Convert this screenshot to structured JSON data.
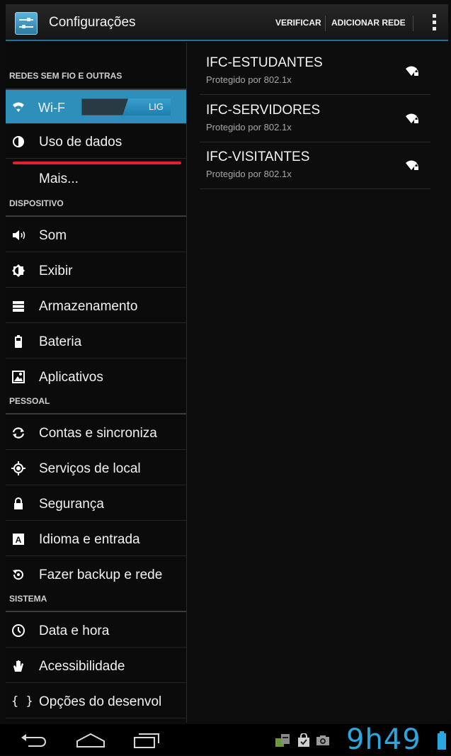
{
  "app": {
    "title": "Configurações"
  },
  "actionbar": {
    "verify_label": "VERIFICAR",
    "add_network_label": "ADICIONAR REDE"
  },
  "sections": {
    "wireless": "REDES SEM FIO E OUTRAS",
    "device": "DISPOSITIVO",
    "personal": "PESSOAL",
    "system": "SISTEMA"
  },
  "items": {
    "wifi": {
      "label": "Wi-F",
      "toggle": "LIG",
      "icon": "wifi-icon",
      "on": true
    },
    "data_usage": {
      "label": "Uso de dados",
      "icon": "data-usage-icon"
    },
    "more": {
      "label": "Mais..."
    },
    "sound": {
      "label": "Som",
      "icon": "speaker-icon"
    },
    "display": {
      "label": "Exibir",
      "icon": "brightness-icon"
    },
    "storage": {
      "label": "Armazenamento",
      "icon": "storage-icon"
    },
    "battery": {
      "label": "Bateria",
      "icon": "battery-icon"
    },
    "apps": {
      "label": "Aplicativos",
      "icon": "apps-icon"
    },
    "accounts": {
      "label": "Contas e sincroniza",
      "icon": "sync-icon"
    },
    "location": {
      "label": "Serviços de local",
      "icon": "location-icon"
    },
    "security": {
      "label": "Segurança",
      "icon": "lock-icon"
    },
    "language": {
      "label": "Idioma e entrada",
      "icon": "keyboard-icon"
    },
    "backup": {
      "label": "Fazer backup e rede",
      "icon": "backup-icon"
    },
    "datetime": {
      "label": "Data e hora",
      "icon": "clock-icon"
    },
    "accessibility": {
      "label": "Acessibilidade",
      "icon": "hand-icon"
    },
    "developer": {
      "label": "Opções do desenvol",
      "icon": "braces-icon"
    }
  },
  "networks": [
    {
      "ssid": "IFC-ESTUDANTES",
      "security": "Protegido por 802.1x"
    },
    {
      "ssid": "IFC-SERVIDORES",
      "security": "Protegido por 802.1x"
    },
    {
      "ssid": "IFC-VISITANTES",
      "security": "Protegido por 802.1x"
    }
  ],
  "statusbar": {
    "time": "9h49"
  },
  "colors": {
    "accent": "#2e8fbb",
    "clock": "#2aa7e0",
    "underline": "#e0202a"
  }
}
